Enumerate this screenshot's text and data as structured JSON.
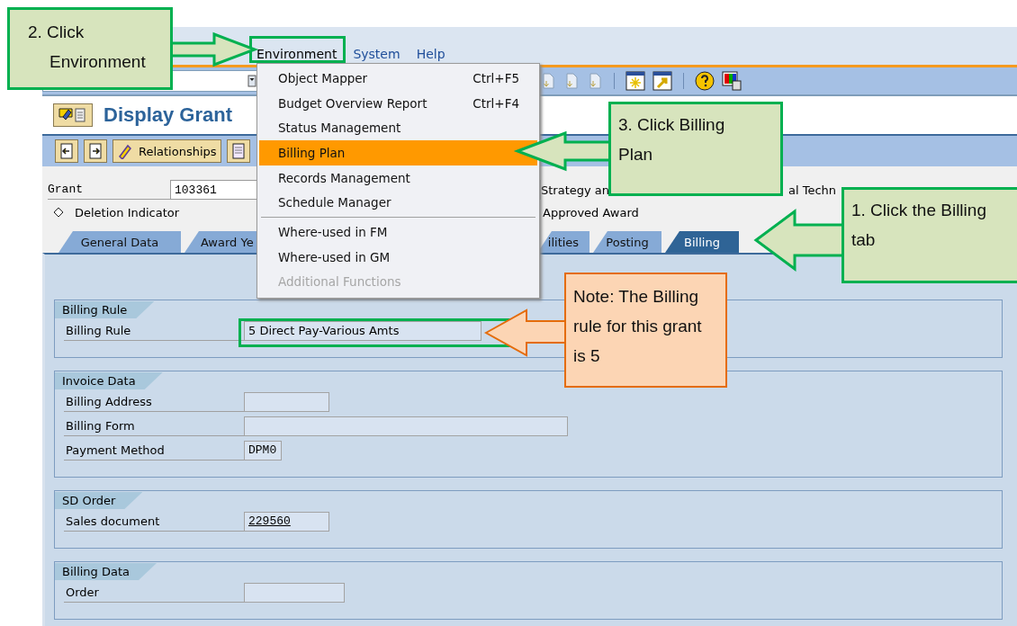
{
  "menu_bar": [
    {
      "label": "Environment",
      "selected": true
    },
    {
      "label": "System",
      "selected": false
    },
    {
      "label": "Help",
      "selected": false
    }
  ],
  "environment_menu": [
    {
      "label": "Object Mapper",
      "shortcut": "Ctrl+F5",
      "selected": false,
      "disabled": false
    },
    {
      "label": "Budget Overview Report",
      "shortcut": "Ctrl+F4",
      "selected": false,
      "disabled": false
    },
    {
      "label": "Status Management",
      "selected": false,
      "disabled": false
    },
    {
      "label": "Billing Plan",
      "selected": true,
      "disabled": false
    },
    {
      "label": "Records Management",
      "selected": false,
      "disabled": false
    },
    {
      "label": "Schedule Manager",
      "selected": false,
      "disabled": false
    },
    {
      "kind": "separator"
    },
    {
      "label": "Where-used in FM",
      "selected": false,
      "disabled": false
    },
    {
      "label": "Where-used in GM",
      "selected": false,
      "disabled": false
    },
    {
      "label": "Additional Functions",
      "selected": false,
      "disabled": true
    }
  ],
  "title": "Display Grant",
  "app_toolbar": {
    "button": "Relationships"
  },
  "header": {
    "grant_label": "Grant",
    "grant_value": "103361",
    "description_start": "Strategy an",
    "description_end": "al Techn",
    "deletion_indicator": "Deletion Indicator",
    "status": "Approved Award"
  },
  "tabs": [
    {
      "label": "General Data",
      "selected": false
    },
    {
      "label": "Award Ye",
      "selected": false
    },
    {
      "label": "ilities",
      "selected": false
    },
    {
      "label": "Posting",
      "selected": false
    },
    {
      "label": "Billing",
      "selected": true
    }
  ],
  "groups": [
    {
      "title": "Billing Rule",
      "rows": [
        {
          "label": "Billing Rule",
          "value": "5 Direct Pay-Various Amts",
          "kind": "wide"
        }
      ]
    },
    {
      "title": "Invoice Data",
      "rows": [
        {
          "label": "Billing Address",
          "kind": "short"
        },
        {
          "label": "Billing Form",
          "kind": "long"
        },
        {
          "label": "Payment Method",
          "value": "DPM0",
          "kind": "tiny"
        }
      ]
    },
    {
      "title": "SD Order",
      "rows": [
        {
          "label": "Sales document",
          "value": "229560",
          "kind": "link"
        }
      ]
    },
    {
      "title": "Billing Data",
      "rows": [
        {
          "label": "Order",
          "kind": "medium"
        }
      ]
    }
  ],
  "callouts": [
    {
      "kind": "step",
      "text": "2. Click Environment"
    },
    {
      "kind": "step",
      "text": "3. Click Billing Plan"
    },
    {
      "kind": "step",
      "text": "1. Click the Billing tab"
    },
    {
      "kind": "note",
      "text": "Note: The Billing rule for this grant is 5"
    }
  ]
}
